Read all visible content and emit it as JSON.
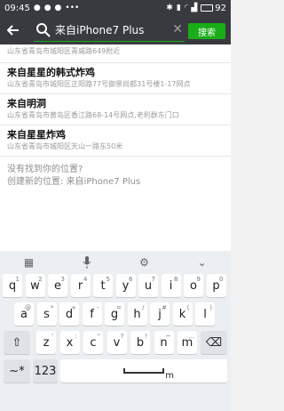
{
  "status_bar": {
    "time": "09:45",
    "battery": "92",
    "battery_percent": 92
  },
  "header": {
    "search_value": "来自iPhone7 Plus",
    "search_button": "搜索"
  },
  "results": [
    {
      "name": "",
      "address": "山东省青岛市城阳区青威路649附近"
    },
    {
      "name": "来自星星的韩式炸鸡",
      "address": "山东省青岛市城阳区正阳路77号御景尚都31号楼1-17网点"
    },
    {
      "name": "来自明洞",
      "address": "山东省青岛市黄岛区香江路68-14号网点,老利群东门口"
    },
    {
      "name": "来自星星炸鸡",
      "address": "山东省青岛市城阳区天山一路东50米"
    }
  ],
  "create": {
    "line1": "没有找到你的位置?",
    "line2": "创建新的位置: 来自iPhone7 Plus"
  },
  "keyboard": {
    "row1": [
      {
        "key": "q",
        "sub": "1"
      },
      {
        "key": "w",
        "sub": "2"
      },
      {
        "key": "e",
        "sub": "3"
      },
      {
        "key": "r",
        "sub": "4"
      },
      {
        "key": "t",
        "sub": "5"
      },
      {
        "key": "y",
        "sub": "6"
      },
      {
        "key": "u",
        "sub": "7"
      },
      {
        "key": "i",
        "sub": "8"
      },
      {
        "key": "o",
        "sub": "9"
      },
      {
        "key": "p",
        "sub": "0"
      }
    ],
    "row2": [
      {
        "key": "a",
        "sub": "@"
      },
      {
        "key": "s",
        "sub": "*"
      },
      {
        "key": "d",
        "sub": "+"
      },
      {
        "key": "f",
        "sub": "-"
      },
      {
        "key": "g",
        "sub": "="
      },
      {
        "key": "h",
        "sub": "/"
      },
      {
        "key": "j",
        "sub": "#"
      },
      {
        "key": "k",
        "sub": "("
      },
      {
        "key": "l",
        "sub": ")"
      }
    ],
    "row3": [
      {
        "key": "z",
        "sub": "'"
      },
      {
        "key": "x",
        "sub": ":"
      },
      {
        "key": "c",
        "sub": "\""
      },
      {
        "key": "v",
        "sub": "?"
      },
      {
        "key": "b",
        "sub": "!"
      },
      {
        "key": "n",
        "sub": "~"
      },
      {
        "key": "m",
        "sub": "…"
      }
    ],
    "bottom": {
      "sym": "~*",
      "num": "123",
      "space": "m"
    }
  },
  "icons": {
    "back": "arrow-left-icon",
    "search": "search-icon",
    "clear": "close-icon",
    "keyboard_grid": "keyboard-icon",
    "mic": "microphone-icon",
    "settings": "gear-icon",
    "collapse": "chevron-down-icon",
    "shift": "shift-icon",
    "delete": "backspace-icon"
  },
  "colors": {
    "accent": "#1aad19",
    "topbar": "#393a3f"
  }
}
